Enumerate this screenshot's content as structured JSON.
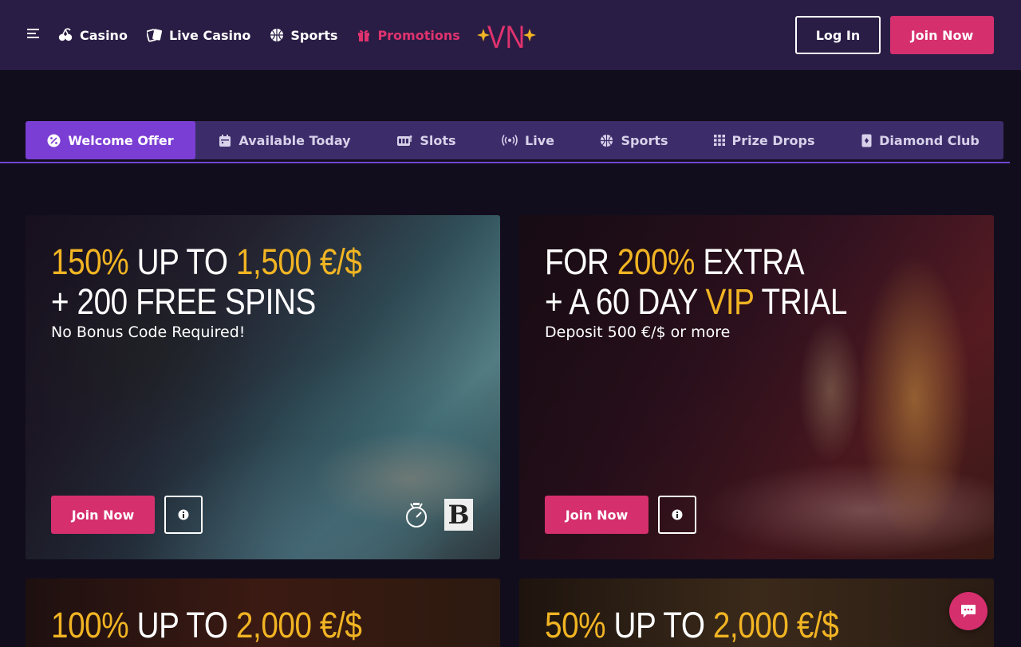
{
  "header": {
    "nav": [
      {
        "label": "Casino",
        "icon": "cherries-icon"
      },
      {
        "label": "Live Casino",
        "icon": "cards-icon"
      },
      {
        "label": "Sports",
        "icon": "basketball-icon"
      },
      {
        "label": "Promotions",
        "icon": "gift-icon"
      }
    ],
    "logo_text": "VN",
    "login_label": "Log In",
    "join_label": "Join Now"
  },
  "tabs": [
    {
      "label": "Welcome Offer",
      "icon": "percent-badge-icon",
      "active": true
    },
    {
      "label": "Available Today",
      "icon": "calendar-icon"
    },
    {
      "label": "Slots",
      "icon": "slot-machine-icon"
    },
    {
      "label": "Live",
      "icon": "broadcast-icon"
    },
    {
      "label": "Sports",
      "icon": "basketball-icon"
    },
    {
      "label": "Prize Drops",
      "icon": "grid-icon"
    },
    {
      "label": "Diamond Club",
      "icon": "diamond-card-icon"
    }
  ],
  "promos": [
    {
      "line1_gold": "150%",
      "line1_rest": " UP TO ",
      "line1_gold2": "1,500 €/$",
      "line2": "+ 200 FREE SPINS",
      "subtext": "No Bonus Code Required!",
      "button": "Join Now",
      "provider_logo": "B"
    },
    {
      "line1_pre": "FOR ",
      "line1_gold": "200%",
      "line1_rest": " EXTRA",
      "line2_pre": "+ A 60 DAY ",
      "line2_gold": "VIP",
      "line2_rest": " TRIAL",
      "subtext": "Deposit 500 €/$ or more",
      "button": "Join Now"
    },
    {
      "line1_gold": "100%",
      "line1_rest": " UP TO ",
      "line1_gold2": "2,000 €/$"
    },
    {
      "line1_gold": "50%",
      "line1_rest": " UP TO ",
      "line1_gold2": "2,000 €/$"
    }
  ],
  "colors": {
    "accent": "#d62f6e",
    "gold": "#f1b423",
    "header_bg": "#2a1d45",
    "tab_active": "#7b3ed4",
    "tab_bg": "#3c2d6a"
  }
}
